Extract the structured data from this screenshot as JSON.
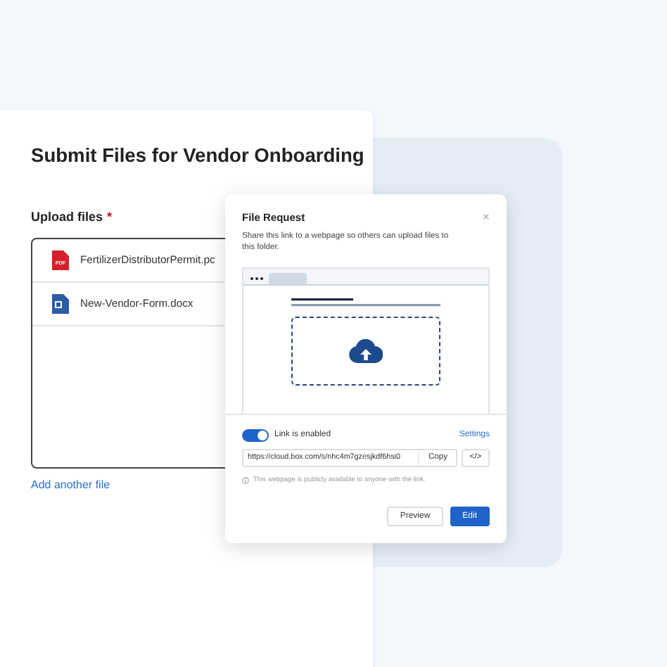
{
  "form": {
    "title": "Submit Files for Vendor Onboarding",
    "upload_label": "Upload files",
    "required_mark": "*",
    "files": [
      {
        "name": "FertilizerDistributorPermit.pc",
        "kind": "pdf",
        "icon_label": "PDF"
      },
      {
        "name": "New-Vendor-Form.docx",
        "kind": "word"
      }
    ],
    "add_link": "Add another file"
  },
  "dialog": {
    "title": "File Request",
    "close": "×",
    "description": "Share this link to a webpage so others can upload files to this folder.",
    "link": {
      "enabled": true,
      "label": "Link is enabled",
      "settings": "Settings",
      "url": "https://cloud.box.com/s/nhc4m7gzesjkdf6hsi0",
      "copy": "Copy",
      "embed": "</>"
    },
    "note": "This webpage is publicly available to anyone with the link.",
    "buttons": [
      {
        "label": "Preview",
        "kind": "secondary"
      },
      {
        "label": "Edit",
        "kind": "primary"
      }
    ]
  }
}
